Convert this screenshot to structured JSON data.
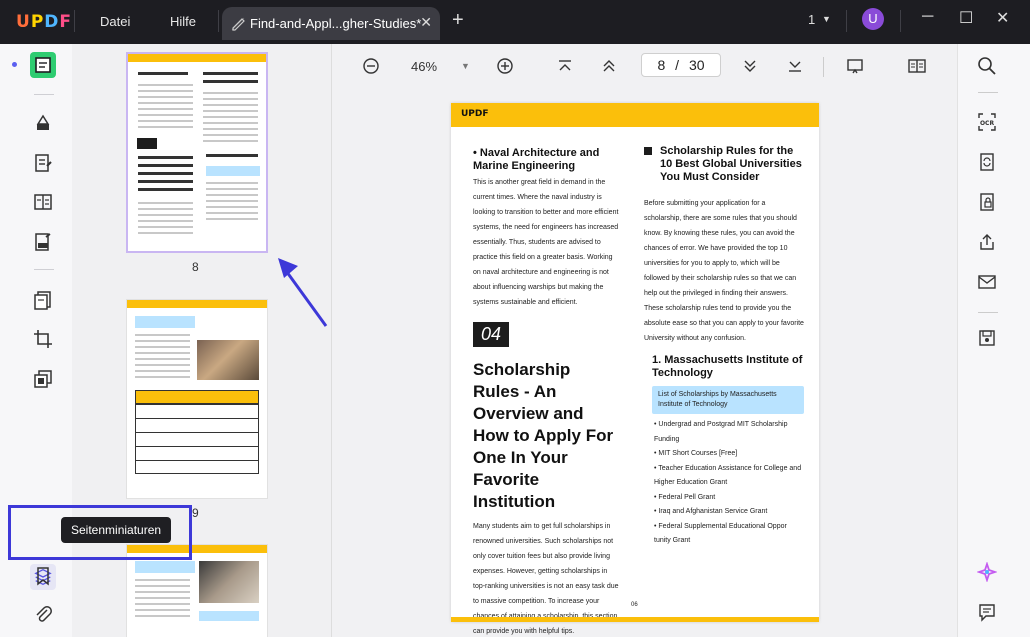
{
  "app": {
    "logo": "UPDF",
    "menu": [
      "Datei",
      "Hilfe"
    ],
    "tab_title": "Find-and-Appl...gher-Studies*",
    "window_count": "1",
    "avatar_letter": "U"
  },
  "sidebar": {
    "tooltip": "Seitenminiaturen"
  },
  "thumbnails": {
    "items": [
      {
        "page": "8"
      },
      {
        "page": "9"
      }
    ]
  },
  "toolbar": {
    "zoom": "46%",
    "current_page": "8",
    "page_sep": "/",
    "total_pages": "30"
  },
  "document": {
    "brand": "UPDF",
    "left": {
      "heading": "Naval Architecture and Marine Engineering",
      "body": "This is another great field in demand in the current times. Where the naval industry is looking to transition to better and more efficient systems, the need for engineers has increased essentially. Thus, students are advised to practice this field on a greater basis. Working on naval architecture and engineering is not about influencing warships but making the systems sustainable and efficient.",
      "number": "04",
      "big_heading": "Scholarship Rules - An Overview and How to Apply For One In Your Favorite Institution",
      "body2": "Many students aim to get full scholarships in renowned universities. Such scholarships not only cover tuition fees but also provide living expenses. However, getting scholarships in top-ranking universities is not an easy task due to massive competition. To increase your chances of attaining a scholarship, this section can provide you with helpful tips."
    },
    "right": {
      "heading": "Scholarship Rules for the 10 Best Global Universities You Must Consider",
      "body": "Before submitting your application for a scholarship, there are some rules that you should know. By knowing these rules, you can avoid the chances of error. We have provided the top 10 universities for you to apply to, which will be followed by their scholarship rules so that we can help out the privileged in finding their answers. These scholarship rules tend to provide you the absolute ease so that you can apply to your favorite University without any confusion.",
      "sub_heading": "1. Massachusetts Institute of Technology",
      "highlight": "List of Scholarships by Massachusetts Institute of Technology",
      "bullets": [
        "Undergrad and Postgrad MIT Scholarship Funding",
        "MIT Short Courses [Free]",
        "Teacher Education Assistance for College and Higher Education Grant",
        "Federal Pell Grant",
        "Iraq and Afghanistan Service Grant",
        "Federal Supplemental Educational Oppor tunity Grant"
      ]
    },
    "page_number": "06"
  },
  "colors": {
    "accent_yellow": "#fbbf0b",
    "highlight_blue": "#b9e3ff",
    "annotation_blue": "#3d38d8"
  }
}
